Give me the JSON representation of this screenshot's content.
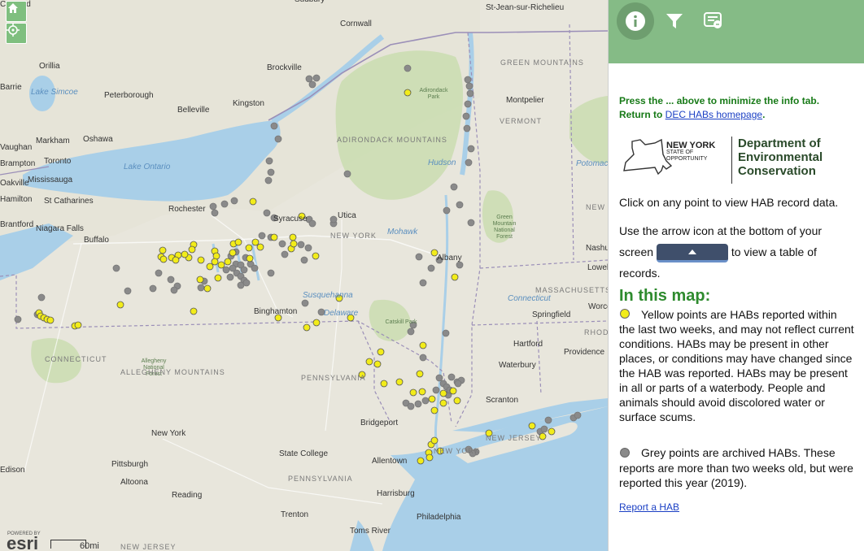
{
  "map": {
    "controls": {
      "home": "home-icon",
      "locate": "locate-icon"
    },
    "labels": [
      {
        "text": "Sudbury",
        "kind": "city"
      },
      {
        "text": "St-Jean-sur-Richelieu",
        "kind": "city"
      },
      {
        "text": "Cornwall",
        "kind": "city"
      },
      {
        "text": "Orillia",
        "kind": "city"
      },
      {
        "text": "Barrie",
        "kind": "city"
      },
      {
        "text": "Lake Simcoe",
        "kind": "water"
      },
      {
        "text": "Peterborough",
        "kind": "city"
      },
      {
        "text": "Brockville",
        "kind": "city"
      },
      {
        "text": "Belleville",
        "kind": "city"
      },
      {
        "text": "Kingston",
        "kind": "city"
      },
      {
        "text": "Oshawa",
        "kind": "city"
      },
      {
        "text": "Markham",
        "kind": "city"
      },
      {
        "text": "Vaughan",
        "kind": "city"
      },
      {
        "text": "Toronto",
        "kind": "city"
      },
      {
        "text": "Lake Ontario",
        "kind": "water"
      },
      {
        "text": "Brampton",
        "kind": "city"
      },
      {
        "text": "Oakville",
        "kind": "city"
      },
      {
        "text": "Mississauga",
        "kind": "city"
      },
      {
        "text": "Hamilton",
        "kind": "city"
      },
      {
        "text": "St Catharines",
        "kind": "city"
      },
      {
        "text": "Brantford",
        "kind": "city"
      },
      {
        "text": "Niagara Falls",
        "kind": "city"
      },
      {
        "text": "Buffalo",
        "kind": "city"
      },
      {
        "text": "Rochester",
        "kind": "city"
      },
      {
        "text": "Syracuse",
        "kind": "city"
      },
      {
        "text": "Utica",
        "kind": "city"
      },
      {
        "text": "NEW YORK",
        "kind": "region"
      },
      {
        "text": "Mohawk",
        "kind": "water"
      },
      {
        "text": "ADIRONDACK MOUNTAINS",
        "kind": "region"
      },
      {
        "text": "Adirondack Park",
        "kind": "park"
      },
      {
        "text": "Hudson",
        "kind": "water"
      },
      {
        "text": "GREEN MOUNTAINS",
        "kind": "region"
      },
      {
        "text": "Montpelier",
        "kind": "city"
      },
      {
        "text": "VERMONT",
        "kind": "region"
      },
      {
        "text": "Albany",
        "kind": "city"
      },
      {
        "text": "Green Mountain National Forest",
        "kind": "park"
      },
      {
        "text": "Nashua",
        "kind": "city"
      },
      {
        "text": "Lowell",
        "kind": "city"
      },
      {
        "text": "MASSACHUSETTS",
        "kind": "region"
      },
      {
        "text": "Worcester",
        "kind": "city"
      },
      {
        "text": "Springfield",
        "kind": "city"
      },
      {
        "text": "Connecticut",
        "kind": "water"
      },
      {
        "text": "Susquehanna",
        "kind": "water"
      },
      {
        "text": "Delaware",
        "kind": "water"
      },
      {
        "text": "Binghamton",
        "kind": "city"
      },
      {
        "text": "Catskill Park",
        "kind": "park"
      },
      {
        "text": "Hartford",
        "kind": "city"
      },
      {
        "text": "Providence",
        "kind": "city"
      },
      {
        "text": "RHODE ISLAND",
        "kind": "region"
      },
      {
        "text": "Waterbury",
        "kind": "city"
      },
      {
        "text": "CONNECTICUT",
        "kind": "region"
      },
      {
        "text": "Allegheny National Forest",
        "kind": "park"
      },
      {
        "text": "ALLEGHENY MOUNTAINS",
        "kind": "region"
      },
      {
        "text": "PENNSYLVANIA",
        "kind": "region"
      },
      {
        "text": "Scranton",
        "kind": "city"
      },
      {
        "text": "Bridgeport",
        "kind": "city"
      },
      {
        "text": "NEW JERSEY",
        "kind": "region"
      },
      {
        "text": "NEW YORK",
        "kind": "region"
      },
      {
        "text": "New York",
        "kind": "city"
      },
      {
        "text": "State College",
        "kind": "city"
      },
      {
        "text": "Allentown",
        "kind": "city"
      },
      {
        "text": "Edison",
        "kind": "city"
      },
      {
        "text": "Pittsburgh",
        "kind": "city"
      },
      {
        "text": "Altoona",
        "kind": "city"
      },
      {
        "text": "PENNSYLVANIA",
        "kind": "region"
      },
      {
        "text": "Reading",
        "kind": "city"
      },
      {
        "text": "Harrisburg",
        "kind": "city"
      },
      {
        "text": "Trenton",
        "kind": "city"
      },
      {
        "text": "Philadelphia",
        "kind": "city"
      },
      {
        "text": "Toms River",
        "kind": "city"
      },
      {
        "text": "NEW JERSEY",
        "kind": "region"
      },
      {
        "text": "Potomac",
        "kind": "water"
      },
      {
        "text": "NEW HAMPSHIRE",
        "kind": "region"
      },
      {
        "text": "Concord",
        "kind": "city"
      }
    ],
    "legend_colors": {
      "recent": "#f2ec1a",
      "archived": "#8a8a8a"
    },
    "scale_label": "60mi",
    "attribution": "POWERED BY",
    "esri_logo": "esri"
  },
  "panel": {
    "tabs": [
      {
        "name": "info-icon",
        "active": true
      },
      {
        "name": "filter-icon",
        "active": false
      },
      {
        "name": "legend-list-icon",
        "active": false
      }
    ],
    "header_color": "#85bb86",
    "minimize_note": "Press the ... above to minimize the info tab.",
    "return_prefix": "Return to ",
    "return_link": "DEC HABs homepage",
    "return_suffix": ".",
    "logo": {
      "ny_line1": "NEW YORK",
      "ny_line2": "STATE OF",
      "ny_line3": "OPPORTUNITY",
      "dept_line1": "Department of",
      "dept_line2": "Environmental",
      "dept_line3": "Conservation"
    },
    "click_text": "Click on any point to view HAB record data.",
    "arrow_text_a": "Use the arrow icon at the bottom of your screen",
    "arrow_text_b": "to view a table of records.",
    "in_this_map": "In this map:",
    "yellow_text": "Yellow points are HABs reported within the last two weeks, and may not reflect current conditions. HABs may be present in other places, or conditions may have changed since the HAB was reported. HABs may be present in all or parts of a waterbody. People and animals should avoid discolored water or surface scums.",
    "grey_text": "Grey points are archived HABs. These reports are more than two weeks old, but were reported this year (2019).",
    "report_link": "Report a HAB"
  }
}
